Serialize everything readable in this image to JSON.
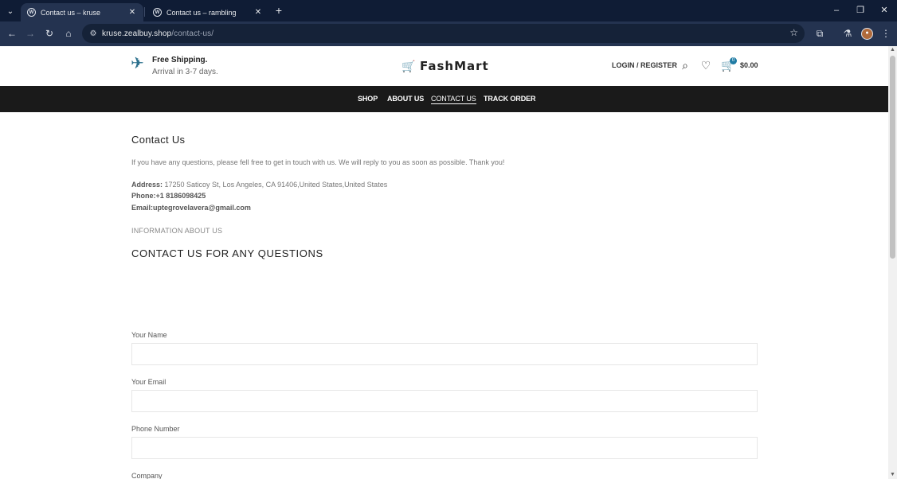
{
  "browser": {
    "tabs": [
      {
        "title": "Contact us – kruse",
        "active": true
      },
      {
        "title": "Contact us – rambling",
        "active": false
      }
    ],
    "url_host": "kruse.zealbuy.shop",
    "url_path": "/contact-us/"
  },
  "header": {
    "shipping_title": "Free Shipping.",
    "shipping_sub": "Arrival in 3-7 days.",
    "logo": "FashMart",
    "login": "LOGIN / REGISTER",
    "cart_count": "0",
    "cart_total": "$0.00"
  },
  "nav": {
    "items": [
      "SHOP",
      "ABOUT US",
      "CONTACT US",
      "TRACK ORDER"
    ],
    "active": "CONTACT US"
  },
  "content": {
    "title": "Contact Us",
    "intro": "If you have any questions, please fell free to get in touch with us. We will reply to you as soon as possible. Thank you!",
    "address_label": "Address:",
    "address": " 17250 Saticoy St, Los Angeles, CA 91406,United States,United States",
    "phone": "Phone:+1 8186098425",
    "email": "Email:uptegrovelavera@gmail.com",
    "info": "INFORMATION ABOUT US",
    "form_title": "CONTACT US FOR ANY QUESTIONS"
  },
  "form": {
    "name_label": "Your Name",
    "email_label": "Your Email",
    "phone_label": "Phone Number",
    "company_label": "Company"
  },
  "colors": {
    "browser_frame": "#0f1c35",
    "toolbar": "#243350",
    "nav_bar": "#1a1a1a",
    "logo_cart": "#c2275f",
    "accent": "#1f7ba4"
  }
}
